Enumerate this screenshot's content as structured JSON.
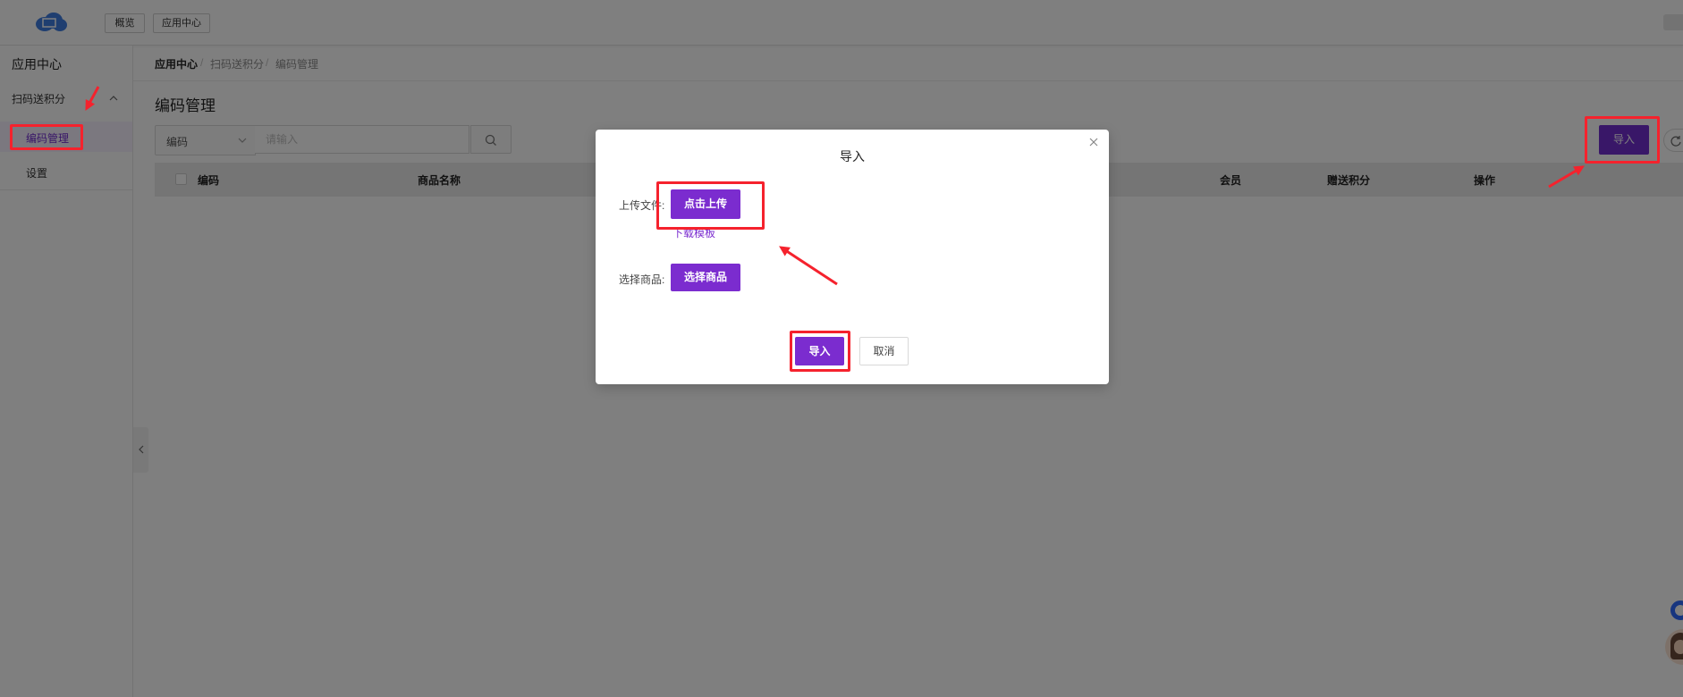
{
  "header": {
    "nav": [
      "概览",
      "应用中心"
    ]
  },
  "sidebar": {
    "title": "应用中心",
    "group": "扫码送积分",
    "items": [
      {
        "label": "编码管理",
        "active": true
      },
      {
        "label": "设置",
        "active": false
      }
    ]
  },
  "breadcrumb": [
    "应用中心",
    "扫码送积分",
    "编码管理"
  ],
  "breadcrumb_separator": "/",
  "page_title": "编码管理",
  "search": {
    "field": "编码",
    "placeholder": "请输入"
  },
  "toolbar": {
    "import_label": "导入"
  },
  "table": {
    "columns": [
      "编码",
      "商品名称",
      "会员",
      "赠送积分",
      "操作"
    ]
  },
  "modal": {
    "title": "导入",
    "upload_label": "上传文件:",
    "upload_button": "点击上传",
    "download_template": "下载模板",
    "product_label": "选择商品:",
    "product_button": "选择商品",
    "confirm": "导入",
    "cancel": "取消"
  },
  "icons": [
    "logo-cloud-icon",
    "chevron-up-icon",
    "chevron-down-icon",
    "search-icon",
    "refresh-icon",
    "close-icon",
    "chevron-left-icon",
    "help-icon",
    "avatar-icon"
  ],
  "colors": {
    "primary": "#722ed1",
    "overlay": "rgba(0,0,0,0.5)",
    "annotation": "#f5222d"
  }
}
